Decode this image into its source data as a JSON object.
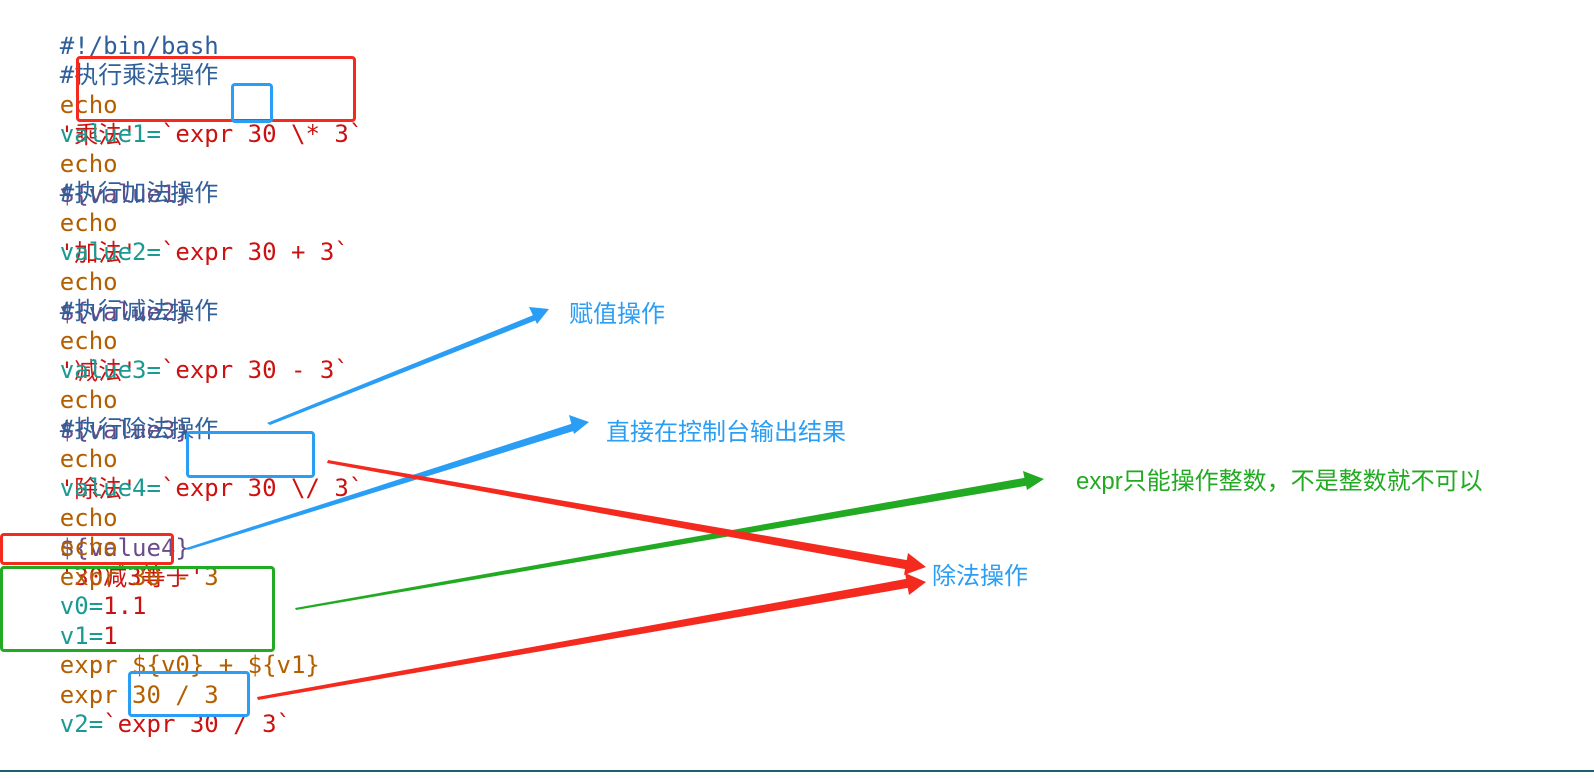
{
  "colors": {
    "blue": "#2a9df4",
    "red": "#f52a1e",
    "green": "#22aa22"
  },
  "code": {
    "shebang": "#!/bin/bash",
    "comment_mul": "#执行乘法操作",
    "echo_mul": "'乘法'",
    "value1_assign": "value1=",
    "value1_expr": "`expr 30 \\* 3`",
    "echo_value1": "${value1}",
    "comment_add": "#执行加法操作",
    "echo_add": "'加法'",
    "value2_assign": "value2=",
    "value2_expr": "`expr 30 + 3`",
    "echo_value2": "${value2}",
    "comment_sub": "#执行减法操作",
    "echo_sub": "'减法'",
    "value3_assign": "value3=",
    "value3_expr": "`expr 30 - 3`",
    "echo_value3": "${value3}",
    "comment_div": "#执行除法操作",
    "echo_div": "'除法'",
    "value4_assign": "value4=",
    "value4_expr": "`expr 30 \\/ 3`",
    "echo_value4": "${value4}",
    "echo_result": "'30减3等于'",
    "expr_sub_direct": "expr 30 - 3",
    "v0_assign": "v0=",
    "v0_value": "1.1",
    "v1_assign": "v1=",
    "v1_value": "1",
    "expr_float": "expr ${v0} + ${v1}",
    "expr_div_direct": "expr 30 / 3",
    "v2_assign": "v2=",
    "v2_expr": "`expr 30 / 3`",
    "keyword_echo": "echo",
    "keyword_expr": "expr"
  },
  "annotations": {
    "assign_label": "赋值操作",
    "console_label": "直接在控制台输出结果",
    "integer_only_label": "expr只能操作整数，不是整数就不可以",
    "division_label": "除法操作"
  }
}
